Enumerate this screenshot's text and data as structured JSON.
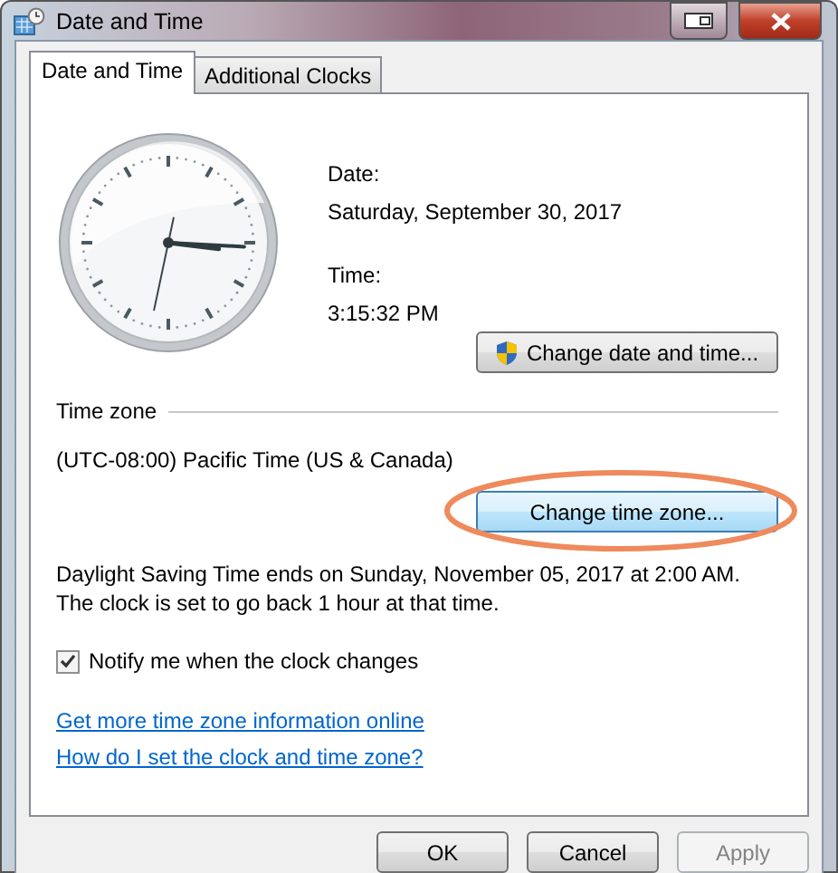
{
  "window": {
    "title": "Date and Time"
  },
  "tabs": [
    {
      "label": "Date and Time",
      "selected": true
    },
    {
      "label": "Additional Clocks",
      "selected": false
    }
  ],
  "date": {
    "label": "Date:",
    "value": "Saturday, September 30, 2017"
  },
  "time": {
    "label": "Time:",
    "value": "3:15:32 PM"
  },
  "change_datetime_button": {
    "label": "Change date and time...",
    "hovered": false
  },
  "time_zone": {
    "heading": "Time zone",
    "value": "(UTC-08:00) Pacific Time (US & Canada)",
    "button": {
      "label": "Change time zone...",
      "hovered": true
    }
  },
  "dst_note": "Daylight Saving Time ends on Sunday, November 05, 2017 at 2:00 AM. The clock is set to go back 1 hour at that time.",
  "notify": {
    "label": "Notify me when the clock changes",
    "checked": true
  },
  "links": [
    "Get more time zone information online",
    "How do I set the clock and time zone?"
  ],
  "buttons": [
    {
      "label": "OK",
      "disabled": false
    },
    {
      "label": "Cancel",
      "disabled": false
    },
    {
      "label": "Apply",
      "disabled": true
    }
  ]
}
